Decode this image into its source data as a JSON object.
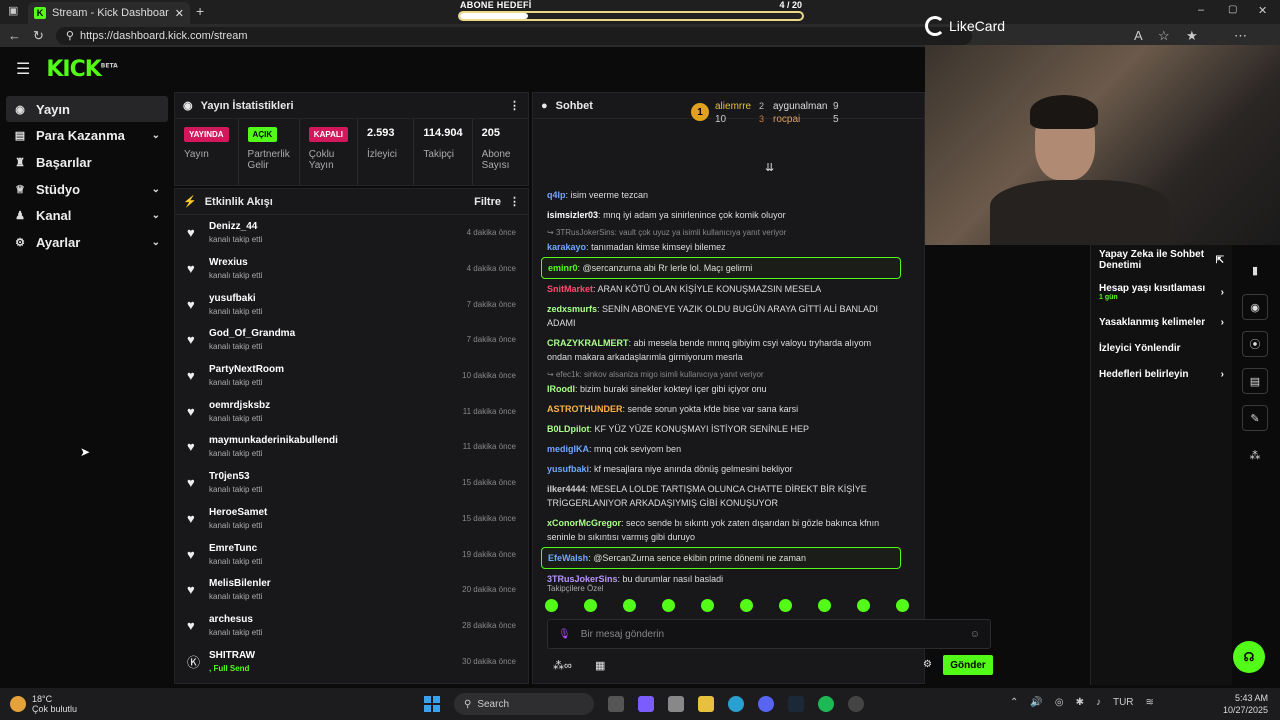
{
  "browser": {
    "tab_title": "Stream - Kick Dashboard",
    "url": "https://dashboard.kick.com/stream"
  },
  "overlay": {
    "goal_title": "ABONE HEDEFİ",
    "goal_count": "4 / 20",
    "goal_progress": 0.2,
    "brand": "LikeCard"
  },
  "header": {
    "logo": "KICK",
    "beta": "BETA"
  },
  "sidebar": {
    "items": [
      {
        "label": "Yayın",
        "icon": "broadcast-icon"
      },
      {
        "label": "Para Kazanma",
        "icon": "money-icon"
      },
      {
        "label": "Başarılar",
        "icon": "trophy-icon"
      },
      {
        "label": "Stüdyo",
        "icon": "studio-icon"
      },
      {
        "label": "Kanal",
        "icon": "channel-icon"
      },
      {
        "label": "Ayarlar",
        "icon": "gear-icon"
      }
    ]
  },
  "stats": {
    "title": "Yayın İstatistikleri",
    "cells": [
      {
        "badge": "YAYINDA",
        "label": "Yayın"
      },
      {
        "badge": "AÇIK",
        "label": "Partnerlik Gelir"
      },
      {
        "badge": "KAPALI",
        "label": "Çoklu Yayın"
      },
      {
        "value": "2.593",
        "label": "İzleyici"
      },
      {
        "value": "114.904",
        "label": "Takipçi"
      },
      {
        "value": "205",
        "label": "Abone Sayısı"
      }
    ]
  },
  "activity": {
    "title": "Etkinlik Akışı",
    "filter": "Filtre",
    "items": [
      {
        "name": "Denizz_44",
        "action": "kanalı takip etti",
        "time": "4 dakika önce"
      },
      {
        "name": "Wrexius",
        "action": "kanalı takip etti",
        "time": "4 dakika önce"
      },
      {
        "name": "yusufbaki",
        "action": "kanalı takip etti",
        "time": "7 dakika önce"
      },
      {
        "name": "God_Of_Grandma",
        "action": "kanalı takip etti",
        "time": "7 dakika önce"
      },
      {
        "name": "PartyNextRoom",
        "action": "kanalı takip etti",
        "time": "10 dakika önce"
      },
      {
        "name": "oemrdjsksbz",
        "action": "kanalı takip etti",
        "time": "11 dakika önce"
      },
      {
        "name": "maymunkaderinikabullendi",
        "action": "kanalı takip etti",
        "time": "11 dakika önce"
      },
      {
        "name": "Tr0jen53",
        "action": "kanalı takip etti",
        "time": "15 dakika önce"
      },
      {
        "name": "HeroeSamet",
        "action": "kanalı takip etti",
        "time": "15 dakika önce"
      },
      {
        "name": "EmreTunc",
        "action": "kanalı takip etti",
        "time": "19 dakika önce"
      },
      {
        "name": "MelisBilenler",
        "action": "kanalı takip etti",
        "time": "20 dakika önce"
      },
      {
        "name": "archesus",
        "action": "kanalı takip etti",
        "time": "28 dakika önce"
      },
      {
        "name": "SHITRAW",
        "action": ", Full Send",
        "time": "30 dakika önce"
      }
    ]
  },
  "chat": {
    "title": "Sohbet",
    "top": [
      {
        "rank": "1",
        "name": "aliemrre",
        "count": "10"
      },
      {
        "rank": "2",
        "name": "aygunalman",
        "count": "9"
      },
      {
        "rank": "3",
        "name": "rocpai",
        "count": "5"
      }
    ],
    "messages": [
      {
        "user": "q4lp",
        "color": "#6ea8ff",
        "text": "isim veerme tezcan"
      },
      {
        "user": "isimsizler03",
        "color": "#ffffff",
        "text": "mnq iyi adam ya sinirlenince çok komik oluyor"
      },
      {
        "reply": "3TRusJokerSins: vault çok uyuz ya isimli kullanıcıya yanıt veriyor"
      },
      {
        "user": "karakayo",
        "color": "#6ea8ff",
        "text": "tanımadan kimse kimseyi bilemez"
      },
      {
        "user": "eminr0",
        "color": "#53fc18",
        "text": "@sercanzurna abi Rr lerle lol. Maçı gelirmi",
        "highlight": true
      },
      {
        "user": "SnitMarket",
        "color": "#ff4a6e",
        "text": "ARAN KÖTÜ OLAN KİŞİYLE KONUŞMAZSIN MESELA"
      },
      {
        "user": "zedxsmurfs",
        "color": "#aaff88",
        "text": "SENİN ABONEYE YAZIK OLDU BUGÜN ARAYA GİTTİ ALİ BANLADI ADAMI"
      },
      {
        "user": "CRAZYKRALMERT",
        "color": "#aaff88",
        "text": "abi mesela bende mnnq gibiyim csyi valoyu tryharda alıyom ondan makara arkadaşlarımla girmiyorum mesrla"
      },
      {
        "reply": "efec1k: sinkov alsaniza migo isimli kullanıcıya yanıt veriyor"
      },
      {
        "user": "IRoodl",
        "color": "#aaff88",
        "text": "bizim buraki sinekler kokteyl içer gibi içiyor onu"
      },
      {
        "user": "ASTROTHUNDER",
        "color": "#ffb347",
        "text": "sende sorun yokta kfde bise var sana karsi"
      },
      {
        "user": "B0LDpilot",
        "color": "#aaff88",
        "text": "KF YÜZ YÜZE KONUŞMAYI İSTİYOR SENİNLE HEP"
      },
      {
        "user": "medigIKA",
        "color": "#6ea8ff",
        "text": "mnq cok seviyom ben"
      },
      {
        "user": "yusufbaki",
        "color": "#6ea8ff",
        "text": "kf mesajlara niye anında dönüş gelmesini bekliyor"
      },
      {
        "user": "ilker4444",
        "color": "#cccccc",
        "text": "MESELA LOLDE TARTIŞMA OLUNCA CHATTE DİREKT BİR KİŞİYE TRİGGERLANIYOR ARKADAŞIYMIŞ GİBİ KONUŞUYOR"
      },
      {
        "user": "xConorMcGregor",
        "color": "#aaff88",
        "text": "seco sende bı sıkıntı yok zaten dışarıdan bi gözle bakınca kfnın seninle bı sıkıntısı varmış gibi duruyo"
      },
      {
        "user": "EfeWalsh",
        "color": "#6ea8ff",
        "text": "@SercanZurna sence ekibin prime dönemi ne zaman",
        "highlight": true
      },
      {
        "user": "3TRusJokerSins",
        "color": "#b894ff",
        "text": "bu durumlar nasıl basladi"
      }
    ],
    "emote_label": "Takipçilere Özel",
    "input_placeholder": "Bir mesaj gönderin",
    "send_label": "Gönder"
  },
  "right_settings": {
    "items": [
      {
        "label": "Yapay Zeka ile Sohbet Denetimi",
        "icon": "external-link-icon"
      },
      {
        "label": "Hesap yaşı kısıtlaması",
        "sub": "1 gün",
        "icon": "chevron-right-icon"
      },
      {
        "label": "Yasaklanmış kelimeler",
        "icon": "chevron-right-icon"
      },
      {
        "label": "İzleyici Yönlendir",
        "icon": ""
      },
      {
        "label": "Hedefleri belirleyin",
        "icon": "chevron-right-icon"
      }
    ]
  },
  "taskbar": {
    "temp": "18°C",
    "weather": "Çok bulutlu",
    "search": "Search",
    "lang": "TUR",
    "time": "5:43 AM",
    "date": "10/27/2025"
  },
  "colors": {
    "accent": "#53fc18",
    "live": "#d2185a"
  }
}
